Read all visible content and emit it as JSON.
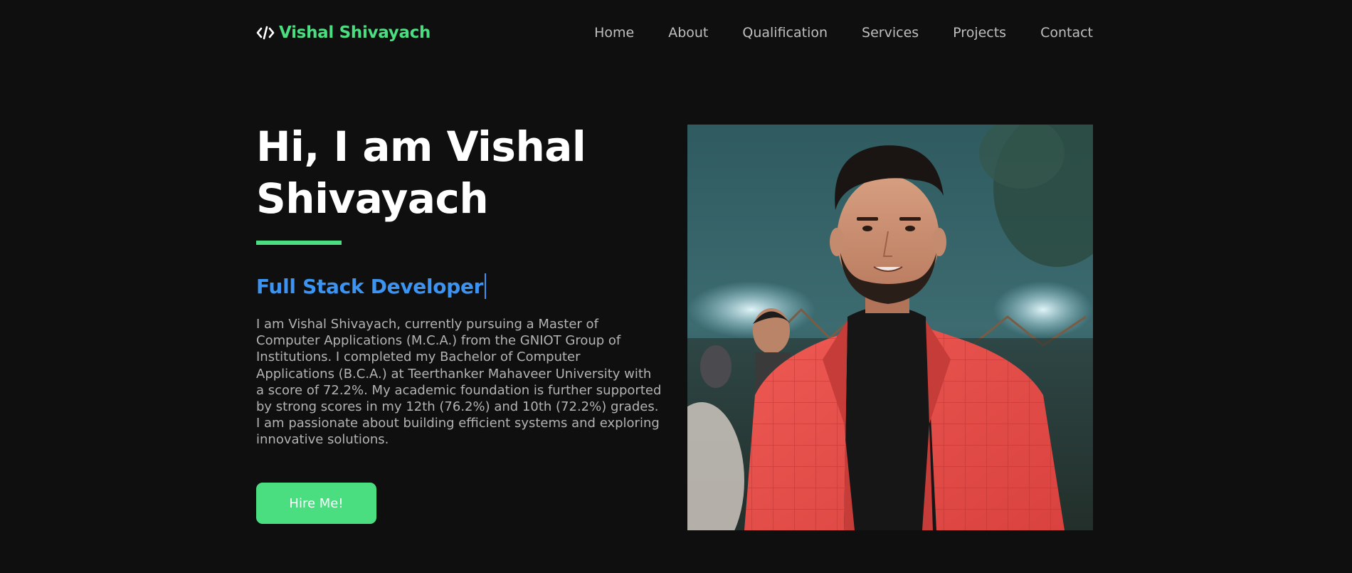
{
  "brand": {
    "name": "Vishal Shivayach",
    "icon": "code-icon",
    "accent_color": "#4ade80"
  },
  "nav": {
    "items": [
      {
        "label": "Home"
      },
      {
        "label": "About"
      },
      {
        "label": "Qualification"
      },
      {
        "label": "Services"
      },
      {
        "label": "Projects"
      },
      {
        "label": "Contact"
      }
    ]
  },
  "hero": {
    "title_line1": "Hi, I am Vishal",
    "title_line2": "Shivayach",
    "subtitle": "Full Stack Developer",
    "subtitle_color": "#3b93f2",
    "bio": "I am Vishal Shivayach, currently pursuing a Master of Computer Applications (M.C.A.) from the GNIOT Group of Institutions. I completed my Bachelor of Computer Applications (B.C.A.) at Teerthanker Mahaveer University with a score of 72.2%. My academic foundation is further supported by strong scores in my 12th (76.2%) and 10th (72.2%) grades. I am passionate about building efficient systems and exploring innovative solutions.",
    "cta_label": "Hire Me!"
  },
  "colors": {
    "background": "#0f0f0f",
    "text_muted": "#bfbfbf"
  }
}
